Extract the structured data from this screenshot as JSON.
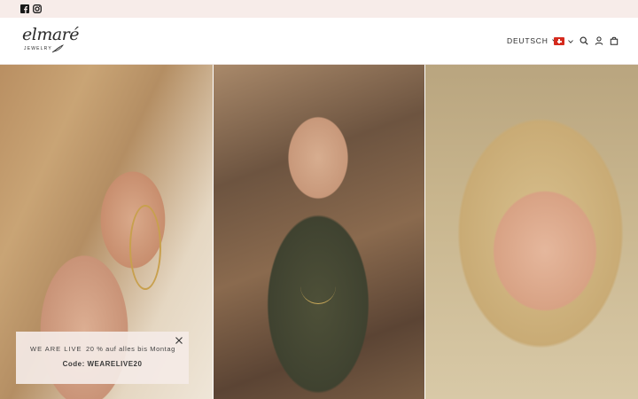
{
  "topbar": {
    "social": [
      {
        "icon": "facebook-icon"
      },
      {
        "icon": "instagram-icon"
      }
    ],
    "background": "#f7ece9"
  },
  "header": {
    "logo": {
      "wordmark": "elmaré",
      "subline": "JEWELRY"
    },
    "language_label": "DEUTSCH",
    "country_flag": "Switzerland",
    "icons": [
      "search-icon",
      "account-icon",
      "cart-icon"
    ]
  },
  "hero": {
    "panels": [
      {
        "subject": "woman-with-hoop-earring-and-rings"
      },
      {
        "subject": "woman-in-green-cardigan"
      },
      {
        "subject": "woman-covering-eyes-with-ringed-hands"
      }
    ]
  },
  "promo": {
    "headline": "WE ARE LIVE",
    "offer": "20 % auf alles bis Montag",
    "code_text": "Code: WEARELIVE20",
    "background": "#f4eae6"
  }
}
